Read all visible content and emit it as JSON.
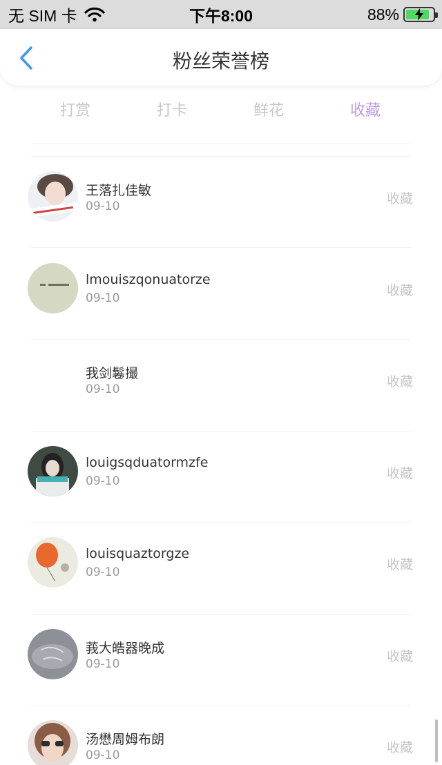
{
  "status_bar": {
    "carrier": "无 SIM 卡",
    "time": "下午8:00",
    "battery": "88%",
    "battery_level": 0.88,
    "battery_color": "#4cd964"
  },
  "nav": {
    "back_icon": "chevron-left-icon",
    "back_color": "#3d98f0",
    "title": "粉丝荣誉榜"
  },
  "tabs": [
    {
      "label": "打赏",
      "active": false
    },
    {
      "label": "打卡",
      "active": false
    },
    {
      "label": "鲜花",
      "active": false
    },
    {
      "label": "收藏",
      "active": true
    }
  ],
  "accent_color": "#c09be8",
  "rows": [
    {
      "name": "王落扎佳敏",
      "date": "09-10",
      "action": "收藏",
      "avatar": "girl-photo"
    },
    {
      "name": "lmouiszqonuatorze",
      "date": "09-10",
      "action": "收藏",
      "avatar": "note-photo"
    },
    {
      "name": "我剑鬈撮",
      "date": "09-10",
      "action": "收藏",
      "avatar": "none"
    },
    {
      "name": "louigsqduatormzfe",
      "date": "09-10",
      "action": "收藏",
      "avatar": "girl-dark-photo"
    },
    {
      "name": "louisquaztorgze",
      "date": "09-10",
      "action": "收藏",
      "avatar": "balloon-photo"
    },
    {
      "name": "莪大皓器晚成",
      "date": "09-10",
      "action": "收藏",
      "avatar": "gray-photo"
    },
    {
      "name": "汤懋周姆布朗",
      "date": "09-10",
      "action": "收藏",
      "avatar": "sunglasses-photo"
    }
  ]
}
